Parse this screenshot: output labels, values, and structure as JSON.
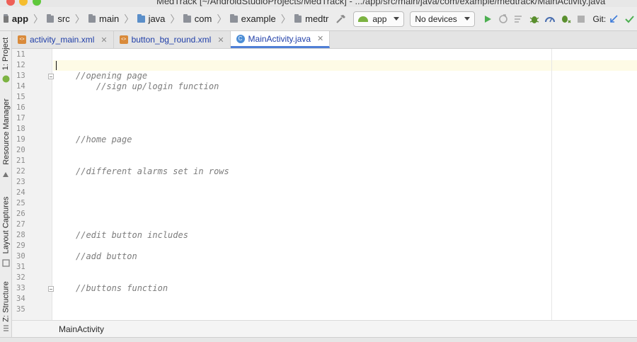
{
  "window": {
    "title": "MedTrack [~/AndroidStudioProjects/MedTrack] - .../app/src/main/java/com/example/medtrack/MainActivity.java"
  },
  "navbar": {
    "breadcrumbs": [
      "app",
      "src",
      "main",
      "java",
      "com",
      "example",
      "medtr"
    ],
    "run_config": "app",
    "device": "No devices",
    "git_label": "Git:"
  },
  "left_tools": [
    {
      "label": "1: Project"
    },
    {
      "label": "Resource Manager"
    },
    {
      "label": "Layout Captures"
    },
    {
      "label": "Z: Structure"
    }
  ],
  "tabs": [
    {
      "label": "activity_main.xml",
      "kind": "xml"
    },
    {
      "label": "button_bg_round.xml",
      "kind": "xml"
    },
    {
      "label": "MainActivity.java",
      "kind": "java",
      "active": true
    }
  ],
  "editor": {
    "line_numbers": [
      "11",
      "12",
      "13",
      "14",
      "15",
      "16",
      "17",
      "18",
      "19",
      "20",
      "21",
      "22",
      "23",
      "24",
      "25",
      "26",
      "27",
      "28",
      "29",
      "30",
      "31",
      "32",
      "33",
      "34",
      "35"
    ],
    "code_lines": [
      {
        "line": 13,
        "text": "//opening page"
      },
      {
        "line": 14,
        "text": "    //sign up/login function"
      },
      {
        "line": 19,
        "text": "//home page"
      },
      {
        "line": 22,
        "text": "//different alarms set in rows"
      },
      {
        "line": 28,
        "text": "//edit button includes"
      },
      {
        "line": 30,
        "text": "//add button"
      },
      {
        "line": 33,
        "text": "//buttons function"
      }
    ]
  },
  "breadcrumb_bar": {
    "label": "MainActivity"
  },
  "colors": {
    "active_tab_underline": "#4f7fd6",
    "caret_line": "#fefbe6",
    "comment_text": "#7c7c7c",
    "run_green": "#4caf50"
  }
}
